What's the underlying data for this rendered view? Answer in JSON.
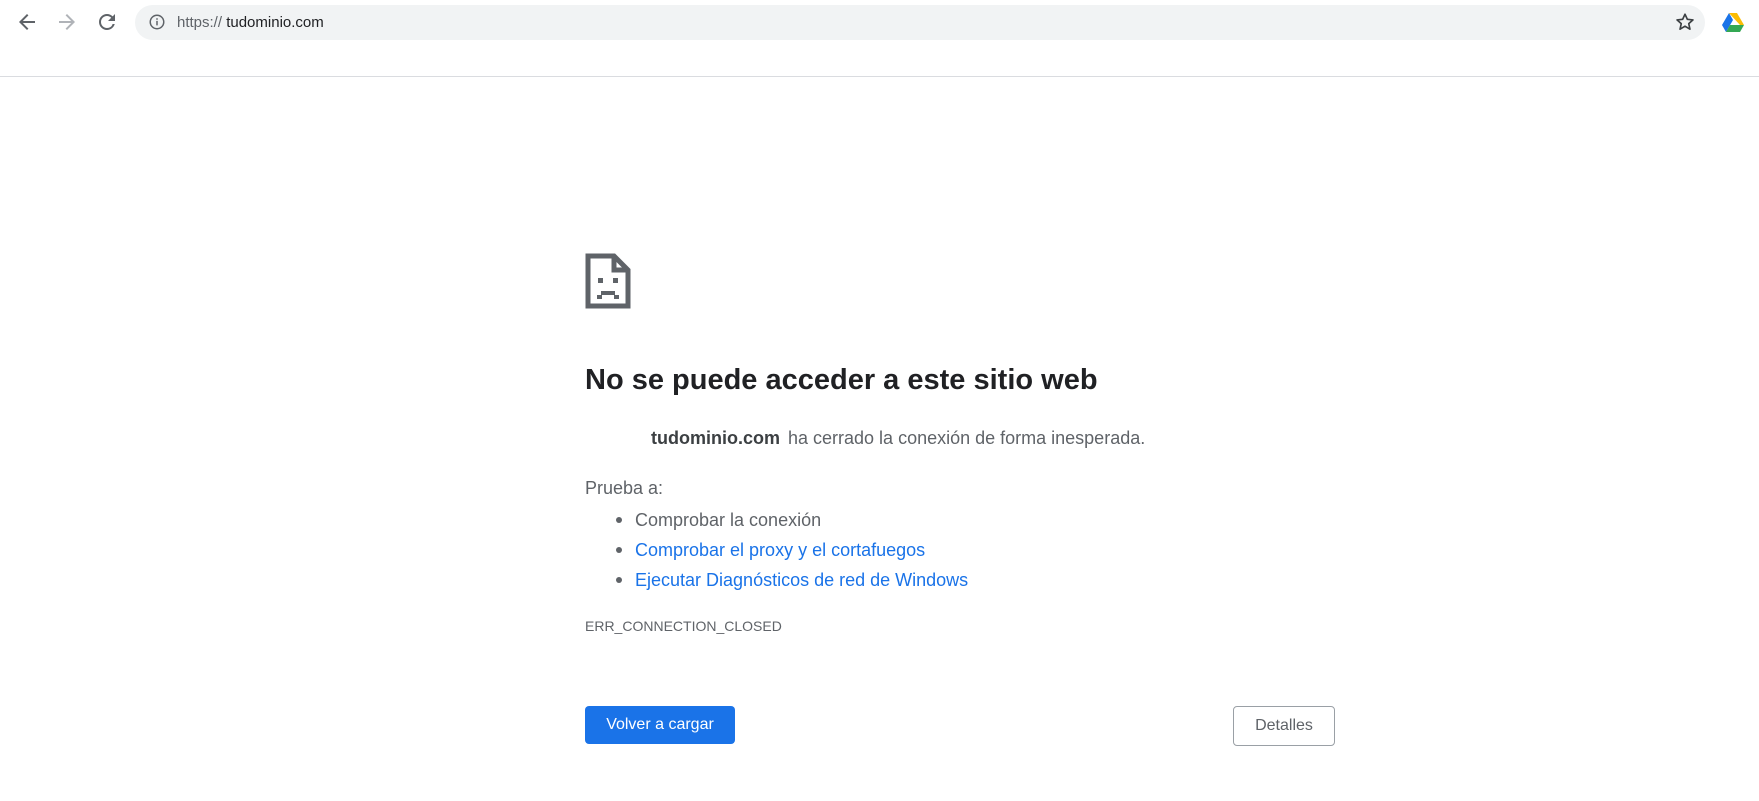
{
  "browser": {
    "url_scheme": "https://",
    "url_host": "tudominio.com",
    "icons": {
      "back": "arrow-left",
      "forward": "arrow-right",
      "reload": "refresh",
      "site_info": "info-circle",
      "bookmark": "star-outline",
      "extension": "google-drive"
    }
  },
  "error_page": {
    "icon": "sad-document",
    "heading": "No se puede acceder a este sitio web",
    "host": "tudominio.com",
    "summary": "ha cerrado la conexión de forma inesperada.",
    "suggestions_label": "Prueba a:",
    "suggestions": [
      {
        "label": "Comprobar la conexión",
        "is_link": false
      },
      {
        "label": "Comprobar el proxy y el cortafuegos",
        "is_link": true
      },
      {
        "label": "Ejecutar Diagnósticos de red de Windows",
        "is_link": true
      }
    ],
    "error_code": "ERR_CONNECTION_CLOSED",
    "reload_label": "Volver a cargar",
    "details_label": "Detalles"
  },
  "colors": {
    "link": "#1a73e8",
    "primary_button": "#1a73e8",
    "text_primary": "#202124",
    "text_secondary": "#5f6368",
    "omnibox_bg": "#f1f3f4"
  }
}
